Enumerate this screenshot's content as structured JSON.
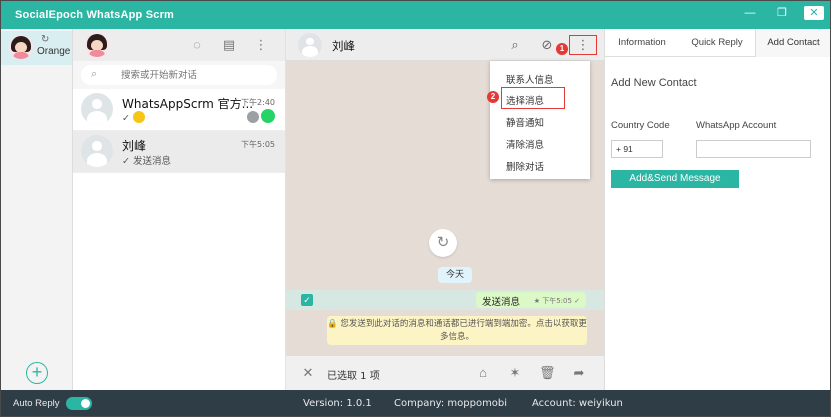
{
  "window": {
    "title": "SocialEpoch WhatsApp Scrm",
    "minimize_glyph": "—",
    "restore_glyph": "❐",
    "close_glyph": "✕"
  },
  "accounts": {
    "items": [
      {
        "name": "Orange",
        "refresh_glyph": "↻"
      }
    ],
    "add_glyph": "+"
  },
  "chatlist": {
    "search_placeholder": "搜索或开始新对话",
    "header_icons": {
      "status": "◌",
      "chat": "▤",
      "menu": "⋮"
    },
    "chats": [
      {
        "name": "WhatsAppScrm 官方...",
        "time": "下午2:40",
        "preview_check": "✓"
      },
      {
        "name": "刘峰",
        "time": "下午5:05",
        "preview": "✓ 发送消息"
      }
    ]
  },
  "chat": {
    "contact_name": "刘峰",
    "icons": {
      "search": "⌕",
      "attach": "⊘",
      "menu": "⋮"
    },
    "badge_1": "1",
    "badge_2": "2",
    "menu_items": [
      "联系人信息",
      "选择消息",
      "静音通知",
      "清除消息",
      "删除对话"
    ],
    "refresh_glyph": "↻",
    "date_chip": "今天",
    "message": {
      "text": "发送消息",
      "time": "★ 下午5:05 ✓",
      "checked_glyph": "✓"
    },
    "notice": "🔒 您发送到此对话的消息和通话都已进行端到端加密。点击以获取更多信息。",
    "selection_footer": {
      "close_glyph": "✕",
      "label": "已选取 1 项",
      "label_icon": "⌂",
      "star_glyph": "✶",
      "delete_glyph": "🗑",
      "forward_glyph": "➦"
    }
  },
  "right_panel": {
    "tabs": [
      "Information",
      "Quick Reply",
      "Add Contact"
    ],
    "active_tab": 2,
    "heading": "Add New Contact",
    "country_code_label": "Country Code",
    "country_code_value": "+ 91",
    "whatsapp_account_label": "WhatsApp Account",
    "whatsapp_account_value": "",
    "submit_label": "Add&Send Message"
  },
  "status_bar": {
    "auto_reply_label": "Auto Reply",
    "auto_reply_on": true,
    "version": "Version: 1.0.1",
    "company": "Company: moppomobi",
    "account": "Account: weiyikun"
  },
  "colors": {
    "brand": "#2bb5a3",
    "status_bar": "#2f3d47",
    "highlight_red": "#e53935",
    "chat_bg": "#e5ddd5",
    "bubble": "#dcf8c6",
    "notice": "#fdf4c5"
  }
}
